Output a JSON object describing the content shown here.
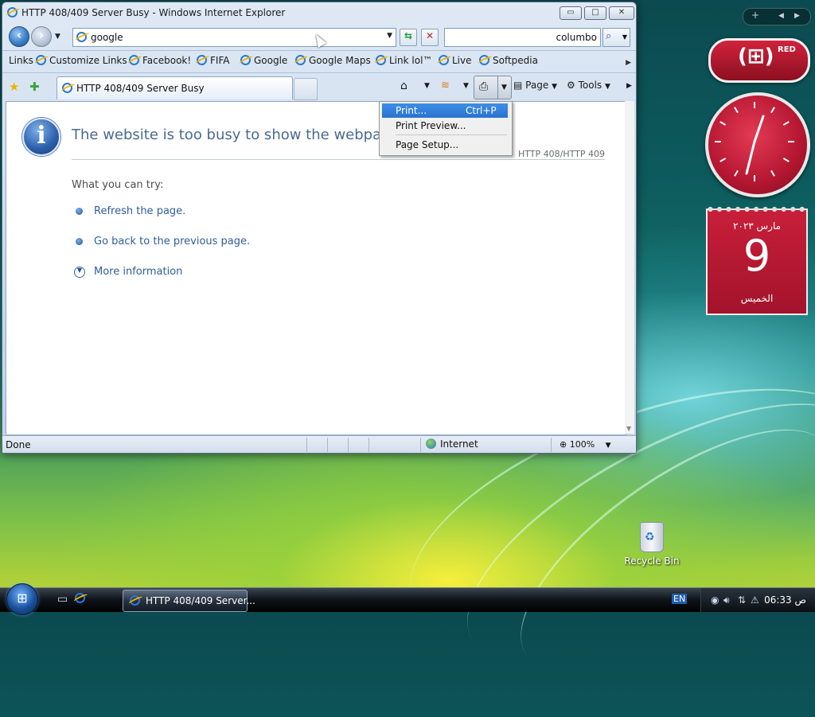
{
  "window": {
    "title": "HTTP 408/409 Server Busy - Windows Internet Explorer",
    "minimize": "▭",
    "maximize": "□",
    "close": "✕"
  },
  "address_bar": {
    "value": "google"
  },
  "search": {
    "value": "columbo"
  },
  "links_bar": {
    "label": "Links",
    "items": [
      "Customize Links",
      "Facebook!",
      "FIFA",
      "Google",
      "Google Maps",
      "Link lol™",
      "Live",
      "Softpedia"
    ]
  },
  "tabs": [
    {
      "label": "HTTP 408/409 Server Busy"
    }
  ],
  "command_bar": {
    "page": "Page",
    "tools": "Tools"
  },
  "print_menu": {
    "items": [
      {
        "label": "Print...",
        "shortcut": "Ctrl+P"
      },
      {
        "label": "Print Preview...",
        "shortcut": ""
      },
      {
        "label": "Page Setup...",
        "shortcut": ""
      }
    ]
  },
  "page": {
    "title": "The website is too busy to show the webpage",
    "code": "HTTP 408/HTTP 409",
    "what_you_can_try": "What you can try:",
    "options": [
      "Refresh the page.",
      "Go back to the previous page."
    ],
    "more_info": "More information"
  },
  "status_bar": {
    "status": "Done",
    "zone": "Internet",
    "zoom": "100%"
  },
  "gadgets": {
    "red_label": "RED",
    "calendar_month": "مارس ٢٠٢٣",
    "calendar_day": "9",
    "calendar_weekday": "الخميس"
  },
  "desktop": {
    "recycle_bin": "Recycle Bin"
  },
  "taskbar": {
    "task_label": "HTTP 408/409 Server...",
    "language": "EN",
    "clock": "06:33 ص"
  }
}
